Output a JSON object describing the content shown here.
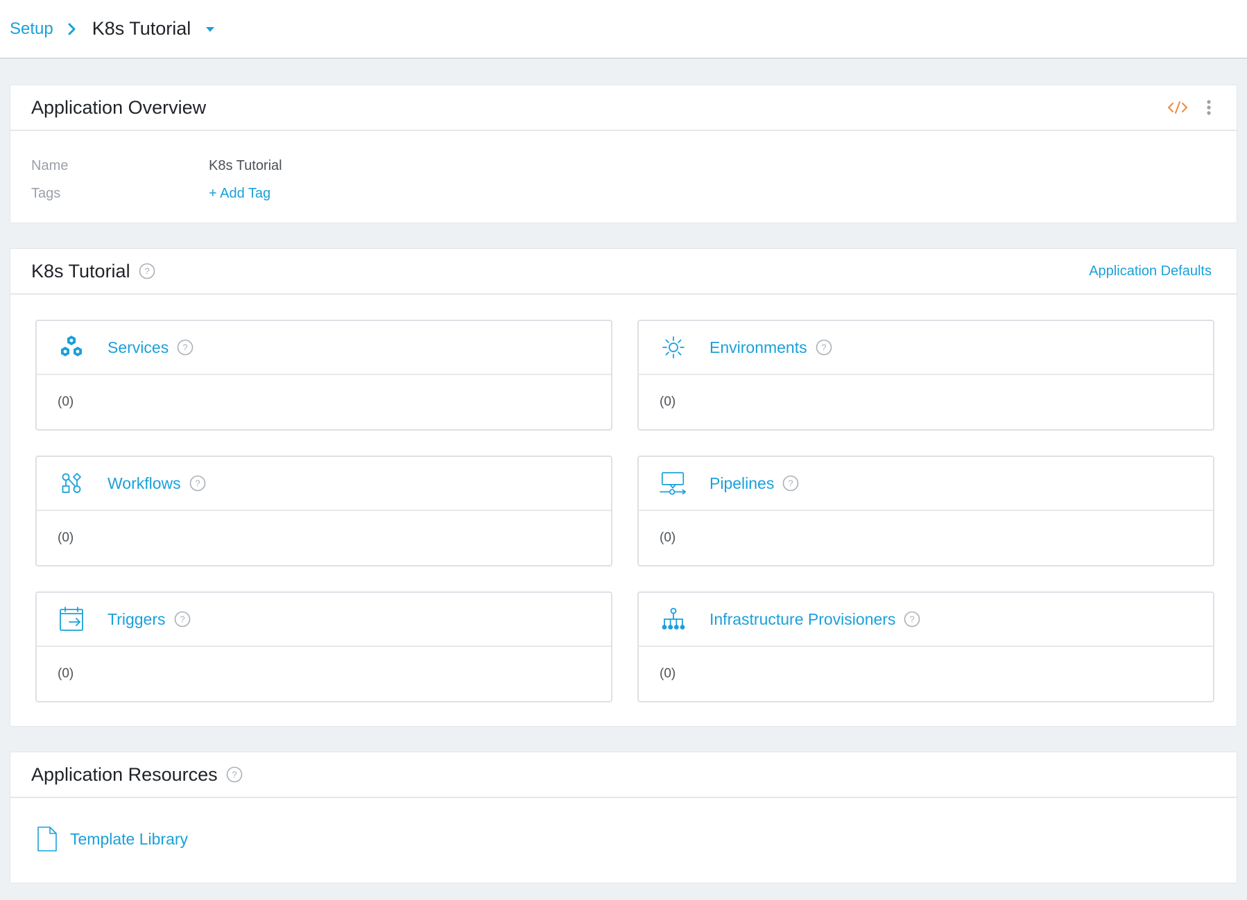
{
  "breadcrumb": {
    "setup_label": "Setup",
    "current_label": "K8s Tutorial"
  },
  "overview": {
    "title": "Application Overview",
    "rows": [
      {
        "label": "Name",
        "value": "K8s Tutorial"
      },
      {
        "label": "Tags",
        "value": "+ Add Tag"
      }
    ]
  },
  "app": {
    "title": "K8s Tutorial",
    "defaults_link": "Application Defaults",
    "tiles": [
      {
        "title": "Services",
        "count": "(0)",
        "icon": "services-icon"
      },
      {
        "title": "Environments",
        "count": "(0)",
        "icon": "environments-icon"
      },
      {
        "title": "Workflows",
        "count": "(0)",
        "icon": "workflows-icon"
      },
      {
        "title": "Pipelines",
        "count": "(0)",
        "icon": "pipelines-icon"
      },
      {
        "title": "Triggers",
        "count": "(0)",
        "icon": "triggers-icon"
      },
      {
        "title": "Infrastructure Provisioners",
        "count": "(0)",
        "icon": "infrastructure-provisioners-icon"
      }
    ]
  },
  "resources": {
    "title": "Application Resources",
    "items": [
      {
        "label": "Template Library",
        "icon": "document-icon"
      }
    ]
  },
  "colors": {
    "accent": "#1aa0da",
    "code_icon": "#f0883a",
    "background": "#eef1f4"
  }
}
